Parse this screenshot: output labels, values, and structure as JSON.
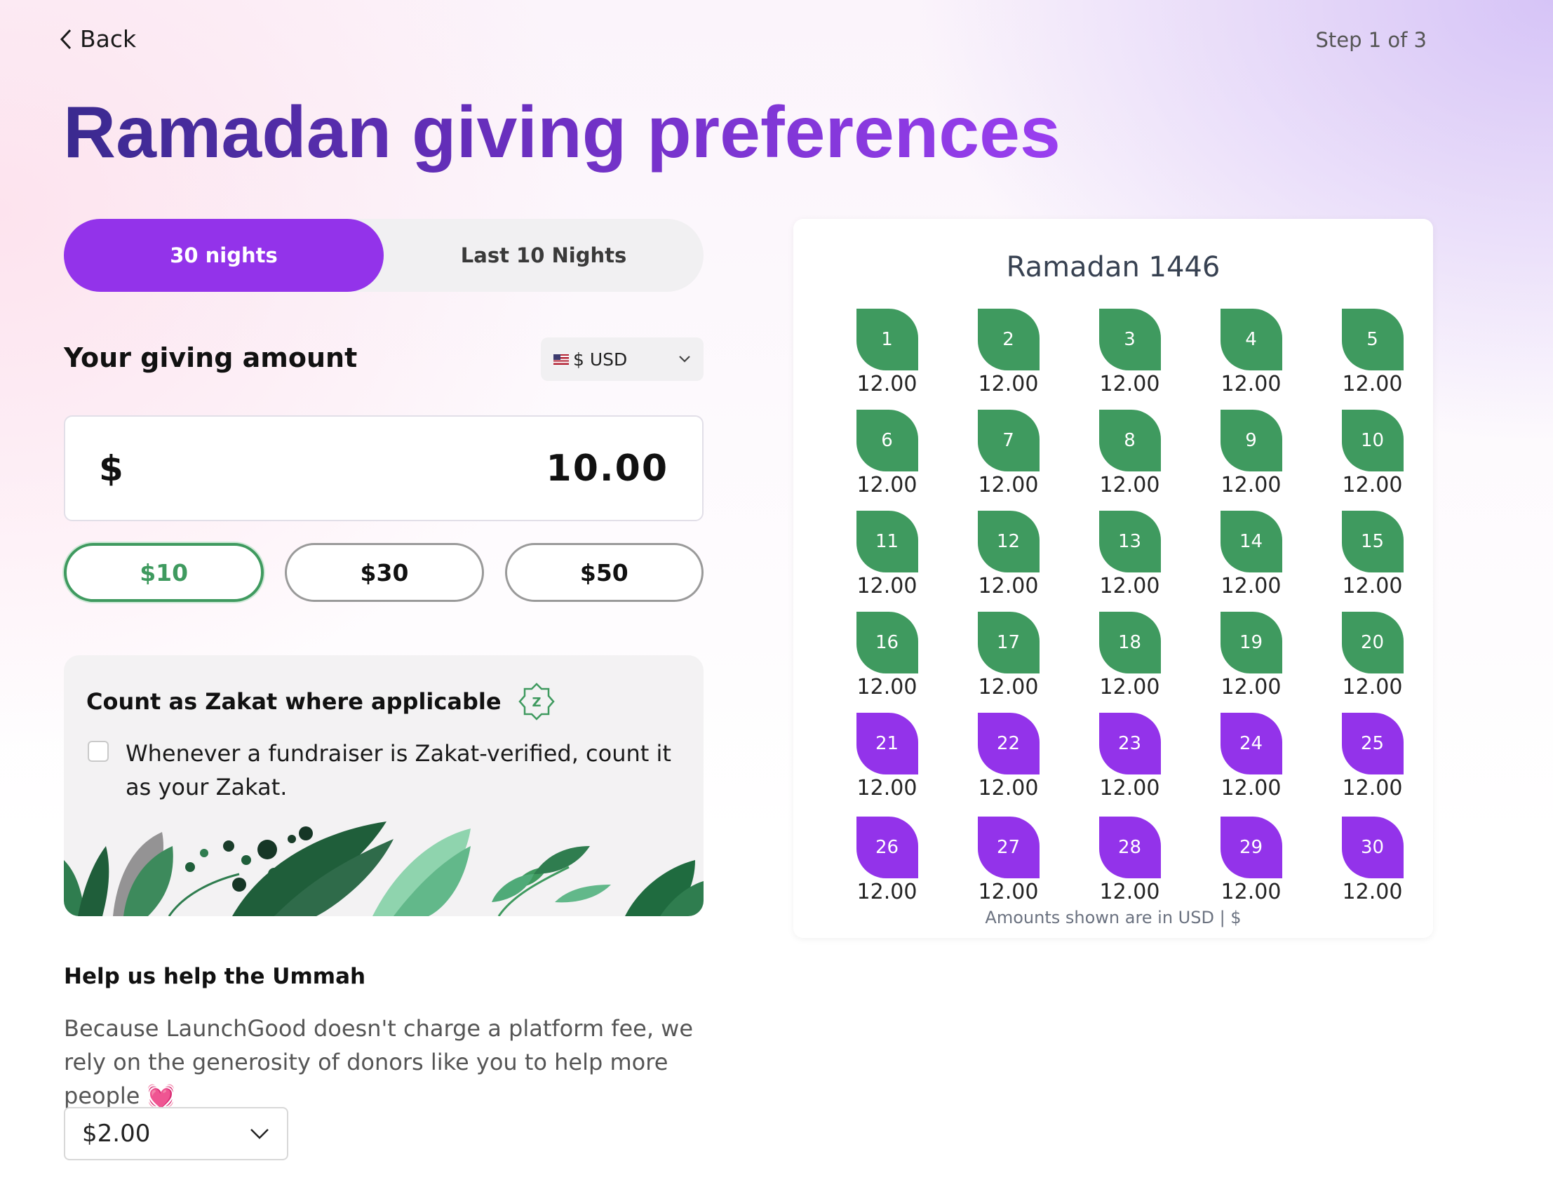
{
  "header": {
    "back_label": "Back",
    "step_label": "Step 1 of 3",
    "title": "Ramadan giving preferences"
  },
  "tabs": [
    {
      "label": "30 nights",
      "active": true
    },
    {
      "label": "Last 10 Nights",
      "active": false
    }
  ],
  "giving": {
    "label": "Your giving amount",
    "currency_label": "$ USD",
    "currency_symbol": "$",
    "amount": "10.00",
    "presets": [
      {
        "label": "$10",
        "active": true
      },
      {
        "label": "$30",
        "active": false
      },
      {
        "label": "$50",
        "active": false
      }
    ]
  },
  "zakat": {
    "title": "Count as Zakat where applicable",
    "badge_letter": "Z",
    "checkbox_checked": false,
    "checkbox_text": "Whenever a fundraiser is Zakat-verified, count it as your Zakat."
  },
  "help": {
    "title": "Help us help the Ummah",
    "text": "Because LaunchGood doesn't charge a platform fee, we rely on the generosity of donors like you to help more people 💓",
    "tip_value": "$2.00"
  },
  "calendar": {
    "title": "Ramadan 1446",
    "note": "Amounts shown are in USD | $",
    "colors": {
      "regular": "#3f9a5f",
      "last_ten": "#9333ea"
    },
    "days": [
      {
        "day": "1",
        "amount": "12.00",
        "last_ten": false
      },
      {
        "day": "2",
        "amount": "12.00",
        "last_ten": false
      },
      {
        "day": "3",
        "amount": "12.00",
        "last_ten": false
      },
      {
        "day": "4",
        "amount": "12.00",
        "last_ten": false
      },
      {
        "day": "5",
        "amount": "12.00",
        "last_ten": false
      },
      {
        "day": "6",
        "amount": "12.00",
        "last_ten": false
      },
      {
        "day": "7",
        "amount": "12.00",
        "last_ten": false
      },
      {
        "day": "8",
        "amount": "12.00",
        "last_ten": false
      },
      {
        "day": "9",
        "amount": "12.00",
        "last_ten": false
      },
      {
        "day": "10",
        "amount": "12.00",
        "last_ten": false
      },
      {
        "day": "11",
        "amount": "12.00",
        "last_ten": false
      },
      {
        "day": "12",
        "amount": "12.00",
        "last_ten": false
      },
      {
        "day": "13",
        "amount": "12.00",
        "last_ten": false
      },
      {
        "day": "14",
        "amount": "12.00",
        "last_ten": false
      },
      {
        "day": "15",
        "amount": "12.00",
        "last_ten": false
      },
      {
        "day": "16",
        "amount": "12.00",
        "last_ten": false
      },
      {
        "day": "17",
        "amount": "12.00",
        "last_ten": false
      },
      {
        "day": "18",
        "amount": "12.00",
        "last_ten": false
      },
      {
        "day": "19",
        "amount": "12.00",
        "last_ten": false
      },
      {
        "day": "20",
        "amount": "12.00",
        "last_ten": false
      },
      {
        "day": "21",
        "amount": "12.00",
        "last_ten": true
      },
      {
        "day": "22",
        "amount": "12.00",
        "last_ten": true
      },
      {
        "day": "23",
        "amount": "12.00",
        "last_ten": true
      },
      {
        "day": "24",
        "amount": "12.00",
        "last_ten": true
      },
      {
        "day": "25",
        "amount": "12.00",
        "last_ten": true
      },
      {
        "day": "26",
        "amount": "12.00",
        "last_ten": true
      },
      {
        "day": "27",
        "amount": "12.00",
        "last_ten": true
      },
      {
        "day": "28",
        "amount": "12.00",
        "last_ten": true
      },
      {
        "day": "29",
        "amount": "12.00",
        "last_ten": true
      },
      {
        "day": "30",
        "amount": "12.00",
        "last_ten": true
      }
    ]
  }
}
